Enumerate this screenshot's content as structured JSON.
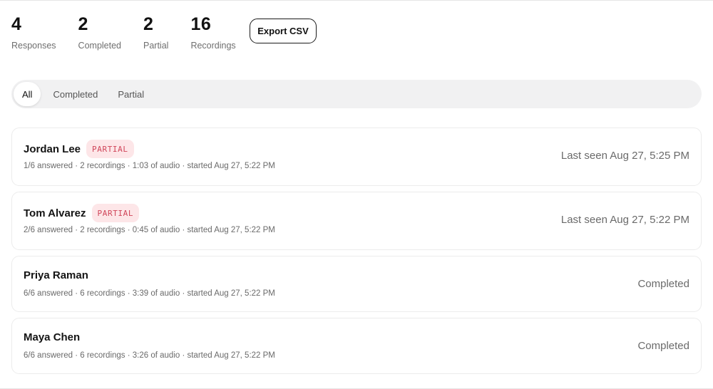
{
  "stats": [
    {
      "value": "4",
      "label": "Responses"
    },
    {
      "value": "2",
      "label": "Completed"
    },
    {
      "value": "2",
      "label": "Partial"
    },
    {
      "value": "16",
      "label": "Recordings"
    }
  ],
  "export_label": "Export CSV",
  "tabs": [
    {
      "label": "All",
      "active": true
    },
    {
      "label": "Completed",
      "active": false
    },
    {
      "label": "Partial",
      "active": false
    }
  ],
  "responses": [
    {
      "name": "Jordan Lee",
      "badge": "PARTIAL",
      "meta": "1/6 answered · 2 recordings · 1:03 of audio · started Aug 27, 5:22 PM",
      "status": "Last seen Aug 27, 5:25 PM"
    },
    {
      "name": "Tom Alvarez",
      "badge": "PARTIAL",
      "meta": "2/6 answered · 2 recordings · 0:45 of audio · started Aug 27, 5:22 PM",
      "status": "Last seen Aug 27, 5:22 PM"
    },
    {
      "name": "Priya Raman",
      "badge": "",
      "meta": "6/6 answered · 6 recordings · 3:39 of audio · started Aug 27, 5:22 PM",
      "status": "Completed"
    },
    {
      "name": "Maya Chen",
      "badge": "",
      "meta": "6/6 answered · 6 recordings · 3:26 of audio · started Aug 27, 5:22 PM",
      "status": "Completed"
    }
  ],
  "colors": {
    "badge_bg": "#fde6e8",
    "badge_text": "#d0465a",
    "tab_track": "#f1f1f2"
  }
}
